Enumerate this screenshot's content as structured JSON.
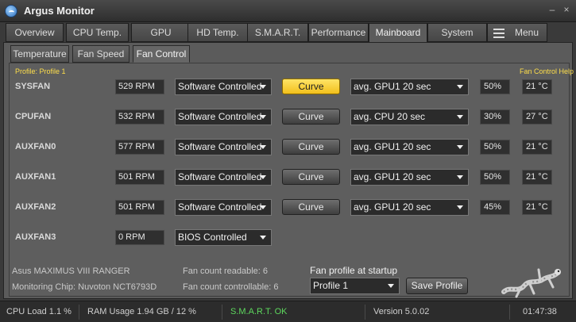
{
  "window": {
    "title": "Argus Monitor"
  },
  "main_tabs": [
    {
      "label": "Overview"
    },
    {
      "label": "CPU Temp."
    },
    {
      "label": "GPU"
    },
    {
      "label": "HD Temp."
    },
    {
      "label": "S.M.A.R.T."
    },
    {
      "label": "Performance"
    },
    {
      "label": "Mainboard",
      "active": true
    },
    {
      "label": "System"
    },
    {
      "label": "Menu"
    }
  ],
  "sub_tabs": [
    {
      "label": "Temperature"
    },
    {
      "label": "Fan Speed"
    },
    {
      "label": "Fan Control",
      "active": true
    }
  ],
  "profile_label": "Profile: Profile 1",
  "help_label": "Fan Control Help",
  "fans": [
    {
      "name": "SYSFAN",
      "rpm": "529 RPM",
      "mode": "Software Controlled",
      "curve": "Curve",
      "curve_active": true,
      "source": "avg. GPU1 20 sec",
      "percent": "50%",
      "temp": "21 °C"
    },
    {
      "name": "CPUFAN",
      "rpm": "532 RPM",
      "mode": "Software Controlled",
      "curve": "Curve",
      "source": "avg. CPU 20 sec",
      "percent": "30%",
      "temp": "27 °C"
    },
    {
      "name": "AUXFAN0",
      "rpm": "577 RPM",
      "mode": "Software Controlled",
      "curve": "Curve",
      "source": "avg. GPU1 20 sec",
      "percent": "50%",
      "temp": "21 °C"
    },
    {
      "name": "AUXFAN1",
      "rpm": "501 RPM",
      "mode": "Software Controlled",
      "curve": "Curve",
      "source": "avg. GPU1 20 sec",
      "percent": "50%",
      "temp": "21 °C"
    },
    {
      "name": "AUXFAN2",
      "rpm": "501 RPM",
      "mode": "Software Controlled",
      "curve": "Curve",
      "source": "avg. GPU1 20 sec",
      "percent": "45%",
      "temp": "21 °C"
    },
    {
      "name": "AUXFAN3",
      "rpm": "0 RPM",
      "mode": "BIOS Controlled"
    }
  ],
  "info": {
    "board": "Asus MAXIMUS VIII RANGER",
    "chip": "Monitoring Chip: Nuvoton NCT6793D",
    "readable": "Fan count readable: 6",
    "controllable": "Fan count controllable: 6"
  },
  "startup": {
    "label": "Fan profile at startup",
    "selected": "Profile 1",
    "save_label": "Save Profile"
  },
  "status": {
    "cpu": "CPU Load 1.1 %",
    "ram": "RAM Usage 1.94 GB / 12 %",
    "smart": "S.M.A.R.T. OK",
    "version": "Version 5.0.02",
    "time": "01:47:38"
  },
  "colors": {
    "accent": "#ffdf4a",
    "curve_active": "#f5c820",
    "smart_ok": "#5dd85d"
  },
  "icons": {
    "app": "argus-logo-icon",
    "menu": "hamburger-icon",
    "dropdown": "chevron-down-icon",
    "mascot": "gecko-icon"
  }
}
